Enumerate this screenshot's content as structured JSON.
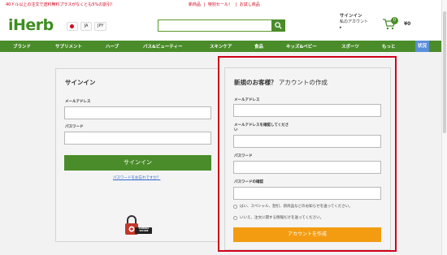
{
  "topbar": {
    "promo": "40ドル以上の注文で送料無料プラスがなくとも5%の割引！",
    "links": [
      "新商品",
      "|",
      "特別セール！",
      "|",
      "お試し商品"
    ]
  },
  "header": {
    "logo": "iHerb",
    "lang": "JA",
    "currency": "JPY",
    "search_placeholder": "",
    "account_title": "サインイン",
    "account_sub": "私のアカウント",
    "account_arrow": "▸",
    "cart_count": "0",
    "cart_total": "¥0"
  },
  "nav": {
    "items": [
      "ブランド",
      "サプリメント",
      "ハーブ",
      "バス&ビューティー",
      "スキンケア",
      "食品",
      "キッズ&ベビー",
      "スポーツ",
      "もっと"
    ],
    "status": "状況"
  },
  "signin": {
    "title": "サインイン",
    "email_label": "メールアドレス",
    "email_value": "",
    "password_label": "パスワード",
    "password_value": "",
    "submit": "サインイン",
    "forgot": "パスワードをお忘れですか？"
  },
  "register": {
    "title_bold": "新規のお客様？",
    "title_rest": " アカウントの作成",
    "email_label": "メールアドレス",
    "email_value": "",
    "confirm_label_1": "メールアドレスを確認してくださ",
    "confirm_label_2": "い",
    "confirm_value": "",
    "password_label": "パスワード",
    "password_value": "",
    "password_confirm_label": "パスワードの確認",
    "password_confirm_value": "",
    "opt_in_yes": "はい、スペシャル、割引、新商品などのお知らせを送ってください。",
    "opt_in_no": "いいえ、注文に関する情報だけを送ってください。",
    "submit": "アカウントを作成"
  },
  "badge": {
    "line1": "COMODO",
    "line2": "SECURE"
  },
  "colors": {
    "brand_green": "#4a8c2a",
    "accent_orange": "#f39c12",
    "highlight_red": "#d0021b"
  }
}
